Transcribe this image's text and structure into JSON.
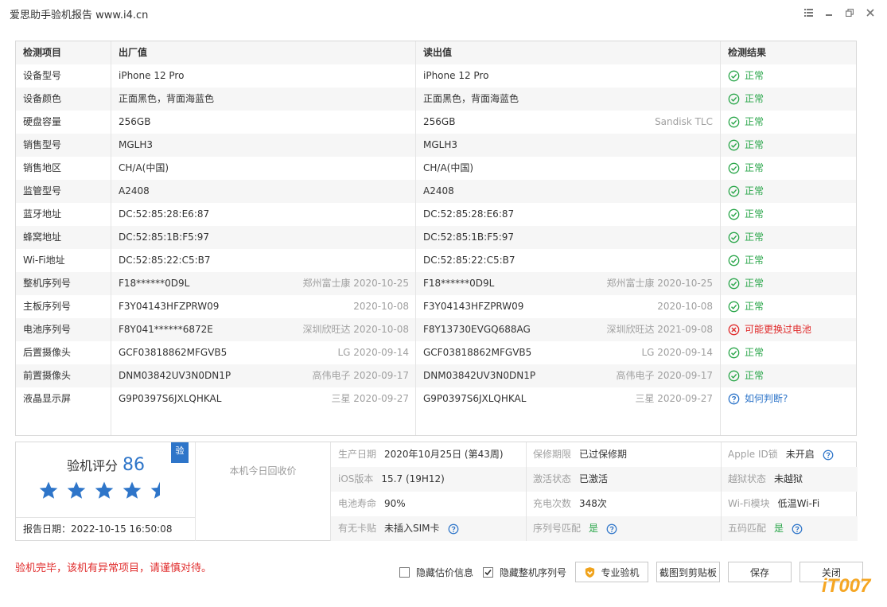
{
  "window": {
    "title": "爱思助手验机报告 www.i4.cn"
  },
  "table": {
    "headers": [
      "检测项目",
      "出厂值",
      "读出值",
      "检测结果"
    ],
    "rows": [
      {
        "name": "设备型号",
        "factory": "iPhone 12 Pro",
        "factory_note": "",
        "read": "iPhone 12 Pro",
        "read_note": "",
        "result": "正常",
        "status": "ok"
      },
      {
        "name": "设备颜色",
        "factory": "正面黑色，背面海蓝色",
        "factory_note": "",
        "read": "正面黑色，背面海蓝色",
        "read_note": "",
        "result": "正常",
        "status": "ok"
      },
      {
        "name": "硬盘容量",
        "factory": "256GB",
        "factory_note": "",
        "read": "256GB",
        "read_note": "Sandisk TLC",
        "result": "正常",
        "status": "ok"
      },
      {
        "name": "销售型号",
        "factory": "MGLH3",
        "factory_note": "",
        "read": "MGLH3",
        "read_note": "",
        "result": "正常",
        "status": "ok"
      },
      {
        "name": "销售地区",
        "factory": "CH/A(中国)",
        "factory_note": "",
        "read": "CH/A(中国)",
        "read_note": "",
        "result": "正常",
        "status": "ok"
      },
      {
        "name": "监管型号",
        "factory": "A2408",
        "factory_note": "",
        "read": "A2408",
        "read_note": "",
        "result": "正常",
        "status": "ok"
      },
      {
        "name": "蓝牙地址",
        "factory": "DC:52:85:28:E6:87",
        "factory_note": "",
        "read": "DC:52:85:28:E6:87",
        "read_note": "",
        "result": "正常",
        "status": "ok"
      },
      {
        "name": "蜂窝地址",
        "factory": "DC:52:85:1B:F5:97",
        "factory_note": "",
        "read": "DC:52:85:1B:F5:97",
        "read_note": "",
        "result": "正常",
        "status": "ok"
      },
      {
        "name": "Wi-Fi地址",
        "factory": "DC:52:85:22:C5:B7",
        "factory_note": "",
        "read": "DC:52:85:22:C5:B7",
        "read_note": "",
        "result": "正常",
        "status": "ok"
      },
      {
        "name": "整机序列号",
        "factory": "F18******0D9L",
        "factory_note": "郑州富士康 2020-10-25",
        "read": "F18******0D9L",
        "read_note": "郑州富士康 2020-10-25",
        "result": "正常",
        "status": "ok"
      },
      {
        "name": "主板序列号",
        "factory": "F3Y04143HFZPRW09",
        "factory_note": "2020-10-08",
        "read": "F3Y04143HFZPRW09",
        "read_note": "2020-10-08",
        "result": "正常",
        "status": "ok"
      },
      {
        "name": "电池序列号",
        "factory": "F8Y041******6872E",
        "factory_note": "深圳欣旺达 2020-10-08",
        "read": "F8Y13730EVGQ688AG",
        "read_note": "深圳欣旺达 2021-09-08",
        "result": "可能更换过电池",
        "status": "bad"
      },
      {
        "name": "后置摄像头",
        "factory": "GCF03818862MFGVB5",
        "factory_note": "LG 2020-09-14",
        "read": "GCF03818862MFGVB5",
        "read_note": "LG 2020-09-14",
        "result": "正常",
        "status": "ok"
      },
      {
        "name": "前置摄像头",
        "factory": "DNM03842UV3N0DN1P",
        "factory_note": "高伟电子 2020-09-17",
        "read": "DNM03842UV3N0DN1P",
        "read_note": "高伟电子 2020-09-17",
        "result": "正常",
        "status": "ok"
      },
      {
        "name": "液晶显示屏",
        "factory": "G9P0397S6JXLQHKAL",
        "factory_note": "三星 2020-09-27",
        "read": "G9P0397S6JXLQHKAL",
        "read_note": "三星 2020-09-27",
        "result": "如何判断?",
        "status": "question"
      }
    ]
  },
  "score": {
    "label": "验机评分",
    "value": "86",
    "badge": "验",
    "stars": 4.5,
    "report_date": "报告日期：2022-10-15 16:50:08"
  },
  "recycle": {
    "label": "本机今日回收价"
  },
  "info": [
    [
      {
        "label": "生产日期",
        "value": "2020年10月25日 (第43周)",
        "green": false,
        "help": false
      },
      {
        "label": "保修期限",
        "value": "已过保修期",
        "green": false,
        "help": false
      },
      {
        "label": "Apple ID锁",
        "value": "未开启",
        "green": false,
        "help": true
      }
    ],
    [
      {
        "label": "iOS版本",
        "value": "15.7 (19H12)",
        "green": false,
        "help": false
      },
      {
        "label": "激活状态",
        "value": "已激活",
        "green": false,
        "help": false
      },
      {
        "label": "越狱状态",
        "value": "未越狱",
        "green": false,
        "help": false
      }
    ],
    [
      {
        "label": "电池寿命",
        "value": "90%",
        "green": false,
        "help": false
      },
      {
        "label": "充电次数",
        "value": "348次",
        "green": false,
        "help": false
      },
      {
        "label": "Wi-Fi模块",
        "value": "低温Wi-Fi",
        "green": false,
        "help": false
      }
    ],
    [
      {
        "label": "有无卡贴",
        "value": "未插入SIM卡",
        "green": false,
        "help": true
      },
      {
        "label": "序列号匹配",
        "value": "是",
        "green": true,
        "help": true
      },
      {
        "label": "五码匹配",
        "value": "是",
        "green": true,
        "help": true
      }
    ]
  ],
  "footer": {
    "warning": "验机完毕，该机有异常项目，请谨慎对待。",
    "hide_price": "隐藏估价信息",
    "hide_price_checked": false,
    "hide_serial": "隐藏整机序列号",
    "hide_serial_checked": true,
    "pro_check": "专业验机",
    "screenshot": "截图到剪贴板",
    "save": "保存",
    "close": "关闭"
  },
  "watermark": "iT007",
  "colors": {
    "ok": "#2aa64a",
    "bad": "#e02b2b",
    "accent": "#2e75c9",
    "star": "#2e75c9"
  }
}
